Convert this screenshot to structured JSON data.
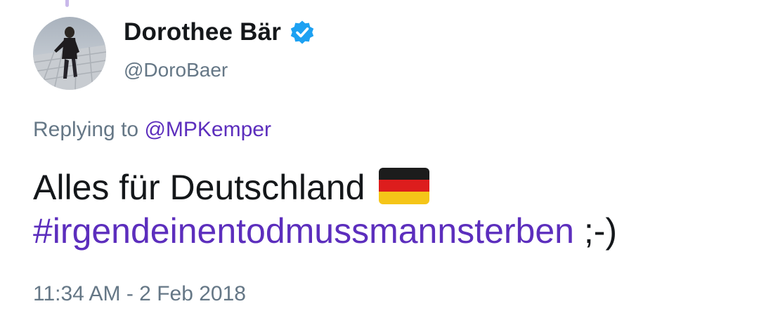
{
  "author": {
    "display_name": "Dorothee Bär",
    "handle": "@DoroBaer",
    "verified_icon": "verified-badge-icon"
  },
  "reply": {
    "prefix": "Replying to",
    "target": "@MPKemper"
  },
  "tweet": {
    "text_main": "Alles für Deutschland",
    "emoji": "german-flag-emoji",
    "hashtag": "#irgendeinentodmussmannsterben",
    "suffix": ";-)"
  },
  "timestamp": "11:34 AM - 2 Feb 2018",
  "colors": {
    "link": "#5c2ebd",
    "muted": "#657786",
    "verified": "#1da1f2",
    "text": "#14171a"
  }
}
